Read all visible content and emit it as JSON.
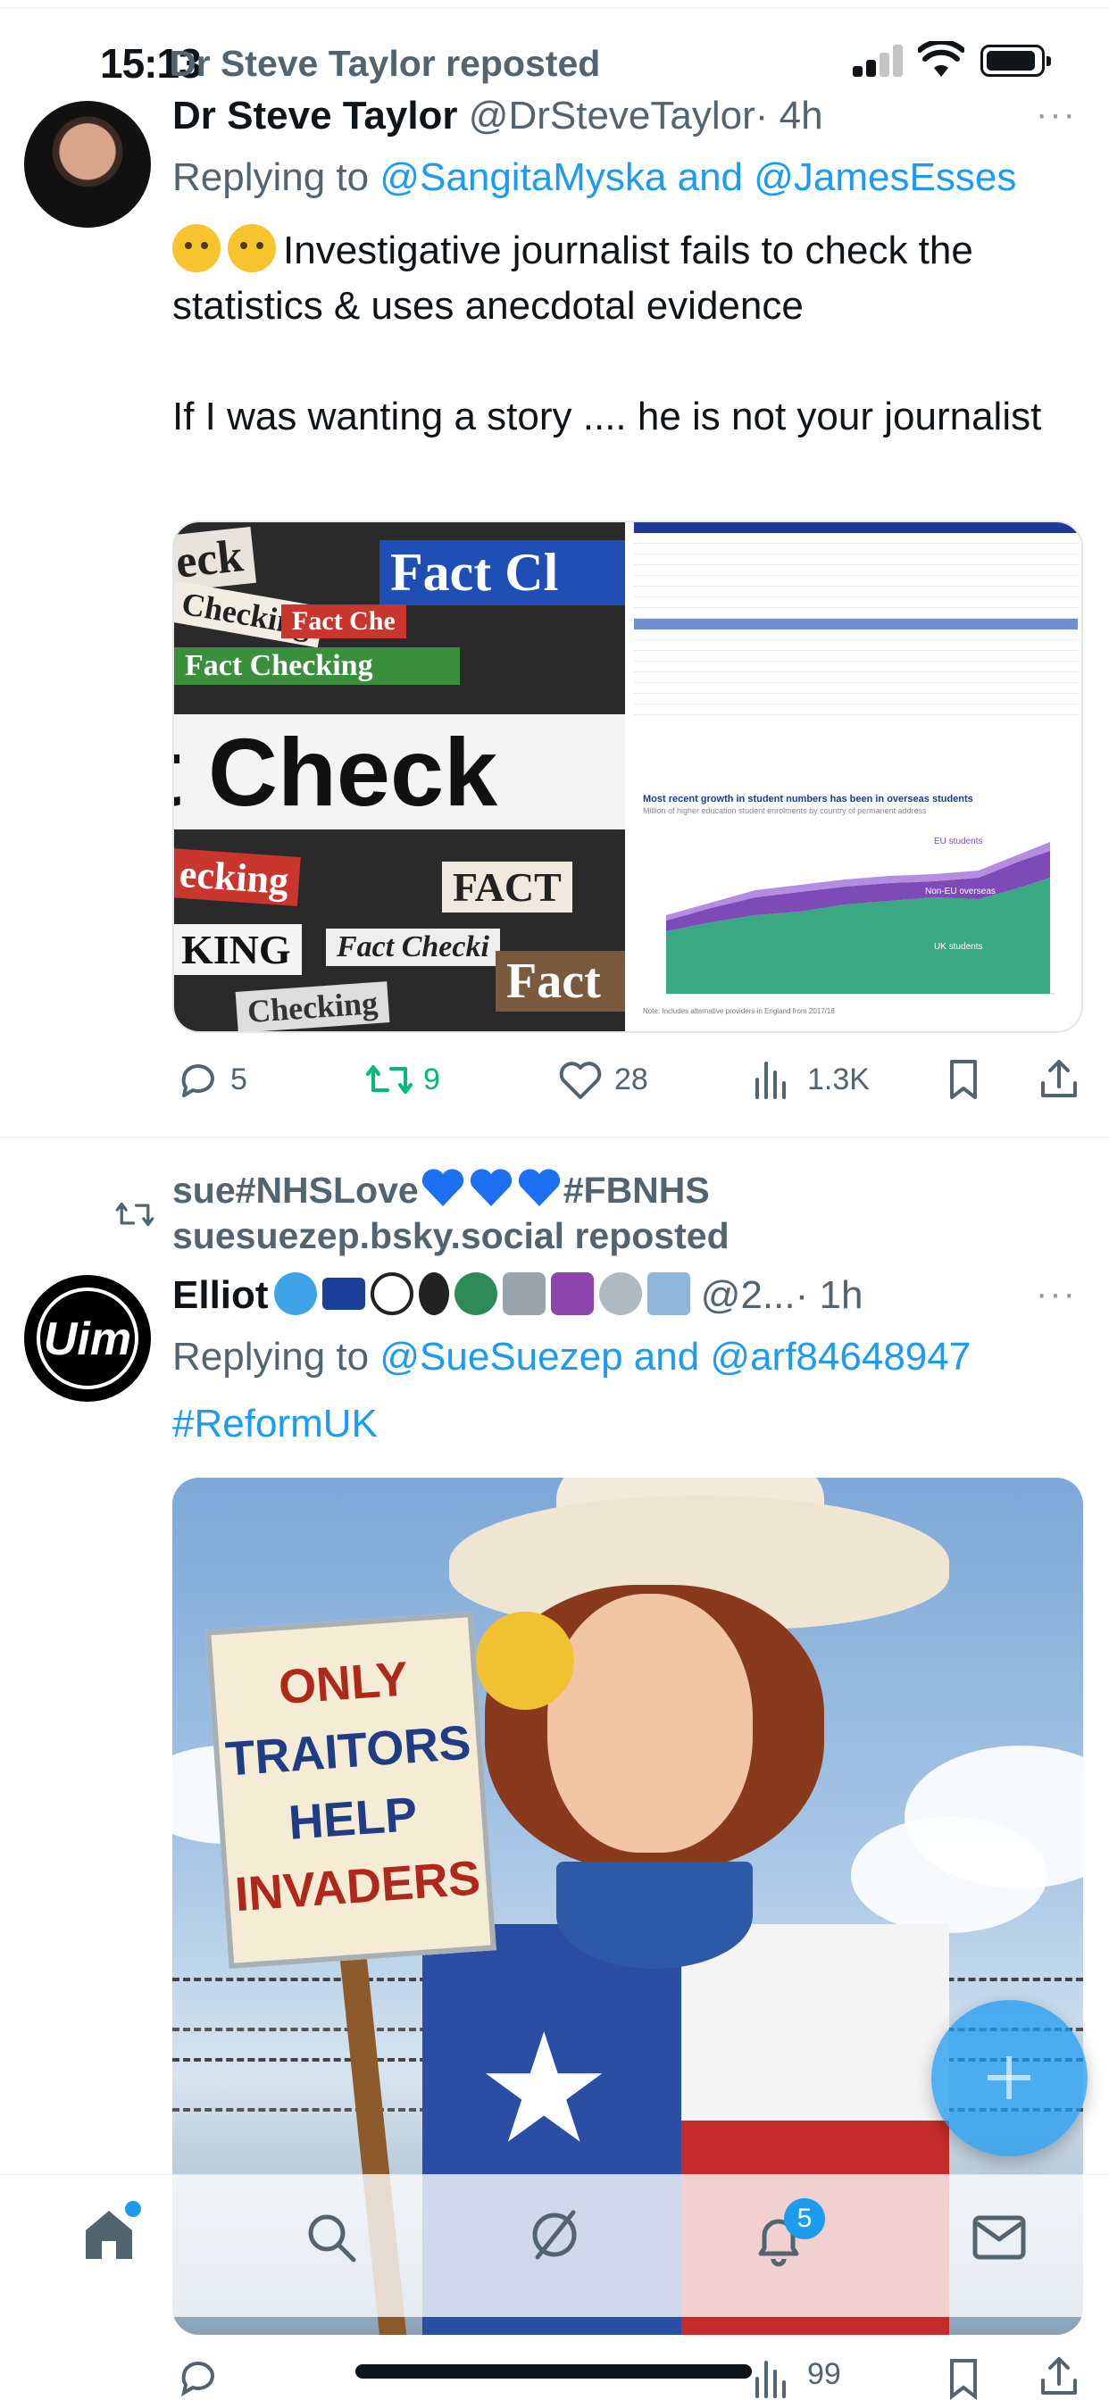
{
  "status_bar": {
    "time": "15:13"
  },
  "tweet1": {
    "repost_label": "Dr Steve Taylor reposted",
    "name": "Dr Steve Taylor",
    "handle": "@DrSteveTaylor",
    "time": "· 4h",
    "replying_prefix": "Replying to",
    "replying_to": "@SangitaMyska and @JamesEsses",
    "text_line1": "Investigative journalist fails to check the statistics & uses anecdotal evidence",
    "text_line2": "If I was wanting a story .... he is not your journalist",
    "media_left": {
      "strips": [
        "eck",
        "Fact Cl",
        "Checking",
        "Fact Che",
        "Fact Checking",
        "t Check",
        "ecking",
        "FACT",
        "KING",
        "Fact Checki",
        "Fact",
        "Checking"
      ]
    },
    "media_right": {
      "chart_title": "Most recent growth in student numbers has been in overseas students",
      "chart_subtitle": "Million of higher education student enrolments by country of permanent address",
      "labels": [
        "EU students",
        "Non-EU overseas",
        "UK students"
      ],
      "note": "Note: Includes alternative providers in England from 2017/18",
      "table_rows": [
        "Christian",
        "Hindu",
        "Jewish",
        "Muslim",
        "Pagan",
        "Sikh",
        "Any other religion or belief",
        "Not known",
        "Ethnicity",
        "White",
        "Black",
        "Asian",
        "Mixed",
        "Other",
        "Not known",
        "Total students with a UK permanent address",
        "Total"
      ]
    },
    "actions": {
      "replies": "5",
      "reposts": "9",
      "likes": "28",
      "views": "1.3K"
    }
  },
  "tweet2": {
    "repost_line1": "sue#NHSLove",
    "repost_line1_suffix": "#FBNHS",
    "repost_line2": "suesuezep.bsky.social reposted",
    "name": "Elliot",
    "handle": "@2...",
    "time": "· 1h",
    "replying_prefix": "Replying to",
    "replying_to": "@SueSuezep and @arf84648947",
    "hashtag": "#ReformUK",
    "sign": [
      "ONLY",
      "TRAITORS",
      "HELP",
      "INVADERS"
    ],
    "avatar_text": "Uim",
    "peek_views": "99"
  },
  "nav": {
    "notifications_badge": "5"
  },
  "colors": {
    "accent": "#1d9bf0",
    "repost_green": "#00ba7c",
    "muted": "#536471"
  }
}
